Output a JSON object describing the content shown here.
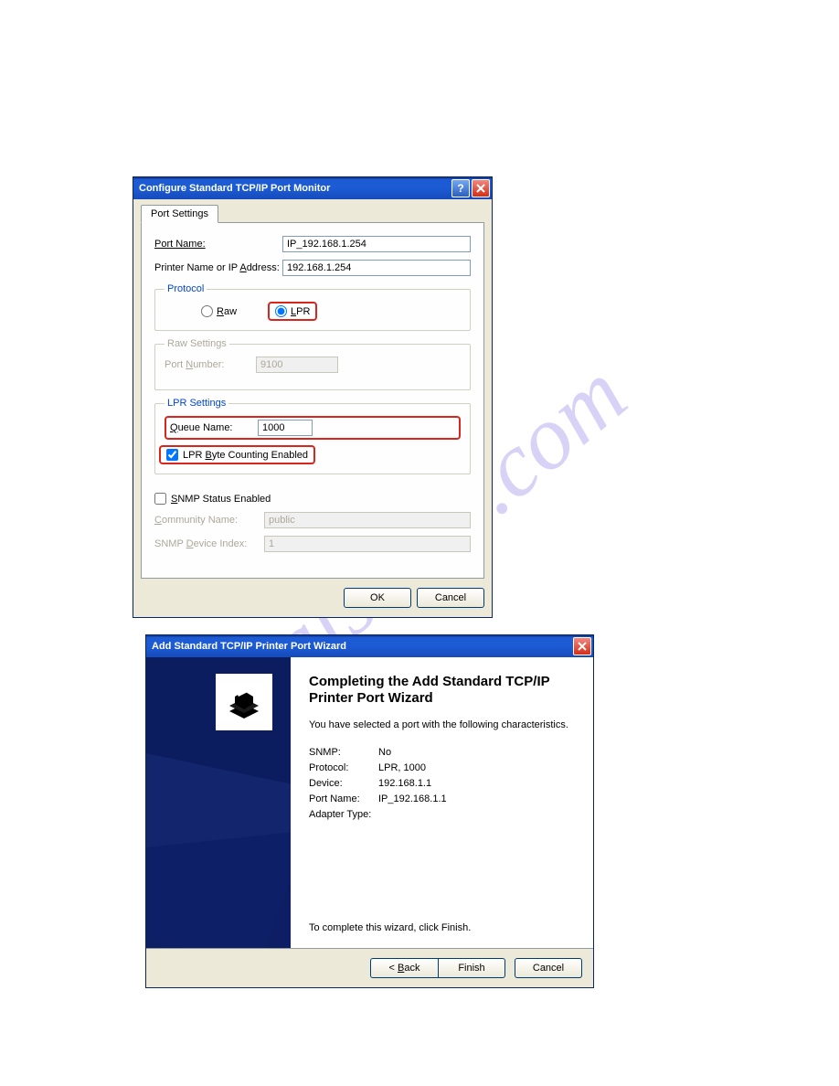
{
  "watermark": "...alshive.com",
  "dialog1": {
    "title": "Configure Standard TCP/IP Port Monitor",
    "tab": "Port Settings",
    "port_name_label": "Port Name:",
    "port_name_value": "IP_192.168.1.254",
    "printer_addr_label_pre": "Printer Name or IP ",
    "printer_addr_label_u": "A",
    "printer_addr_label_post": "ddress:",
    "printer_addr_value": "192.168.1.254",
    "protocol_legend": "Protocol",
    "raw_u": "R",
    "raw_post": "aw",
    "lpr_u": "L",
    "lpr_post": "PR",
    "raw_settings_legend": "Raw Settings",
    "port_number_label_pre": "Port ",
    "port_number_label_u": "N",
    "port_number_label_post": "umber:",
    "port_number_value": "9100",
    "lpr_settings_legend": "LPR Settings",
    "queue_u": "Q",
    "queue_post": "ueue Name:",
    "queue_value": "1000",
    "lpr_byte_pre": "LPR ",
    "lpr_byte_u": "B",
    "lpr_byte_post": "yte Counting Enabled",
    "snmp_u": "S",
    "snmp_post": "NMP Status Enabled",
    "community_u": "C",
    "community_post": "ommunity Name:",
    "community_value": "public",
    "snmp_index_pre": "SNMP ",
    "snmp_index_u": "D",
    "snmp_index_post": "evice Index:",
    "snmp_index_value": "1",
    "ok": "OK",
    "cancel": "Cancel"
  },
  "dialog2": {
    "title": "Add Standard TCP/IP Printer Port Wizard",
    "heading": "Completing the Add Standard TCP/IP Printer Port Wizard",
    "subtext": "You have selected a port with the following characteristics.",
    "rows": {
      "snmp_label": "SNMP:",
      "snmp_value": "No",
      "protocol_label": "Protocol:",
      "protocol_value": "LPR, 1000",
      "device_label": "Device:",
      "device_value": "192.168.1.1",
      "port_label": "Port Name:",
      "port_value": "IP_192.168.1.1",
      "adapter_label": "Adapter Type:",
      "adapter_value": ""
    },
    "finish_note": "To complete this wizard, click Finish.",
    "back_pre": "< ",
    "back_u": "B",
    "back_post": "ack",
    "finish": "Finish",
    "cancel": "Cancel"
  }
}
